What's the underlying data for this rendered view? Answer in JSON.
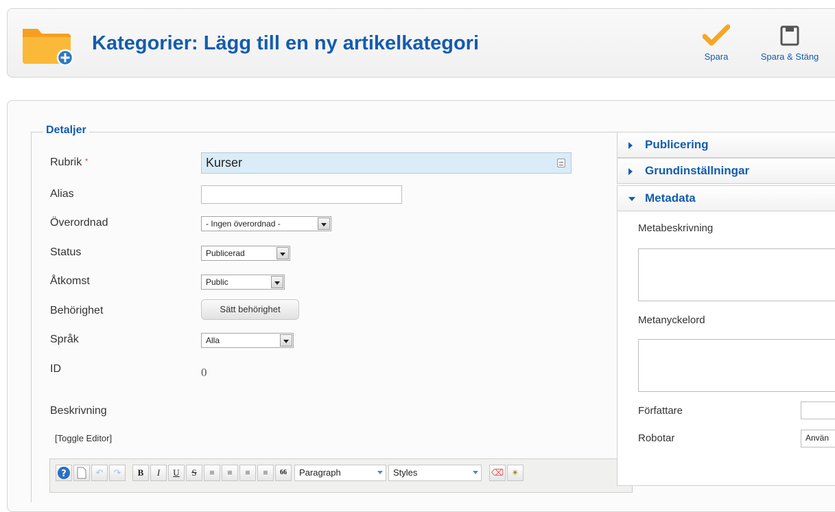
{
  "header": {
    "title": "Kategorier: Lägg till en ny artikelkategori",
    "toolbar": {
      "save_label": "Spara",
      "save_close_label": "Spara & Stäng"
    }
  },
  "details": {
    "legend": "Detaljer",
    "title_label": "Rubrik",
    "required_mark": "*",
    "title_value": "Kurser",
    "alias_label": "Alias",
    "alias_value": "",
    "parent_label": "Överordnad",
    "parent_value": "- Ingen överordnad -",
    "status_label": "Status",
    "status_value": "Publicerad",
    "access_label": "Åtkomst",
    "access_value": "Public",
    "permissions_label": "Behörighet",
    "permissions_button": "Sätt behörighet",
    "language_label": "Språk",
    "language_value": "Alla",
    "id_label": "ID",
    "id_value": "0",
    "description_label": "Beskrivning",
    "toggle_editor": "[Toggle Editor]"
  },
  "editor": {
    "bold": "B",
    "italic": "I",
    "underline": "U",
    "strike": "S",
    "blockquote": "66",
    "format_select": "Paragraph",
    "styles_select": "Styles"
  },
  "sidebar": {
    "publishing": "Publicering",
    "basic_options": "Grundinställningar",
    "metadata": "Metadata",
    "meta_description_label": "Metabeskrivning",
    "meta_keywords_label": "Metanyckelord",
    "author_label": "Författare",
    "robots_label": "Robotar",
    "robots_value": "Använ"
  },
  "colors": {
    "accent": "#135cae",
    "title_input_bg": "#d9ecf8",
    "check": "#f5a623"
  }
}
